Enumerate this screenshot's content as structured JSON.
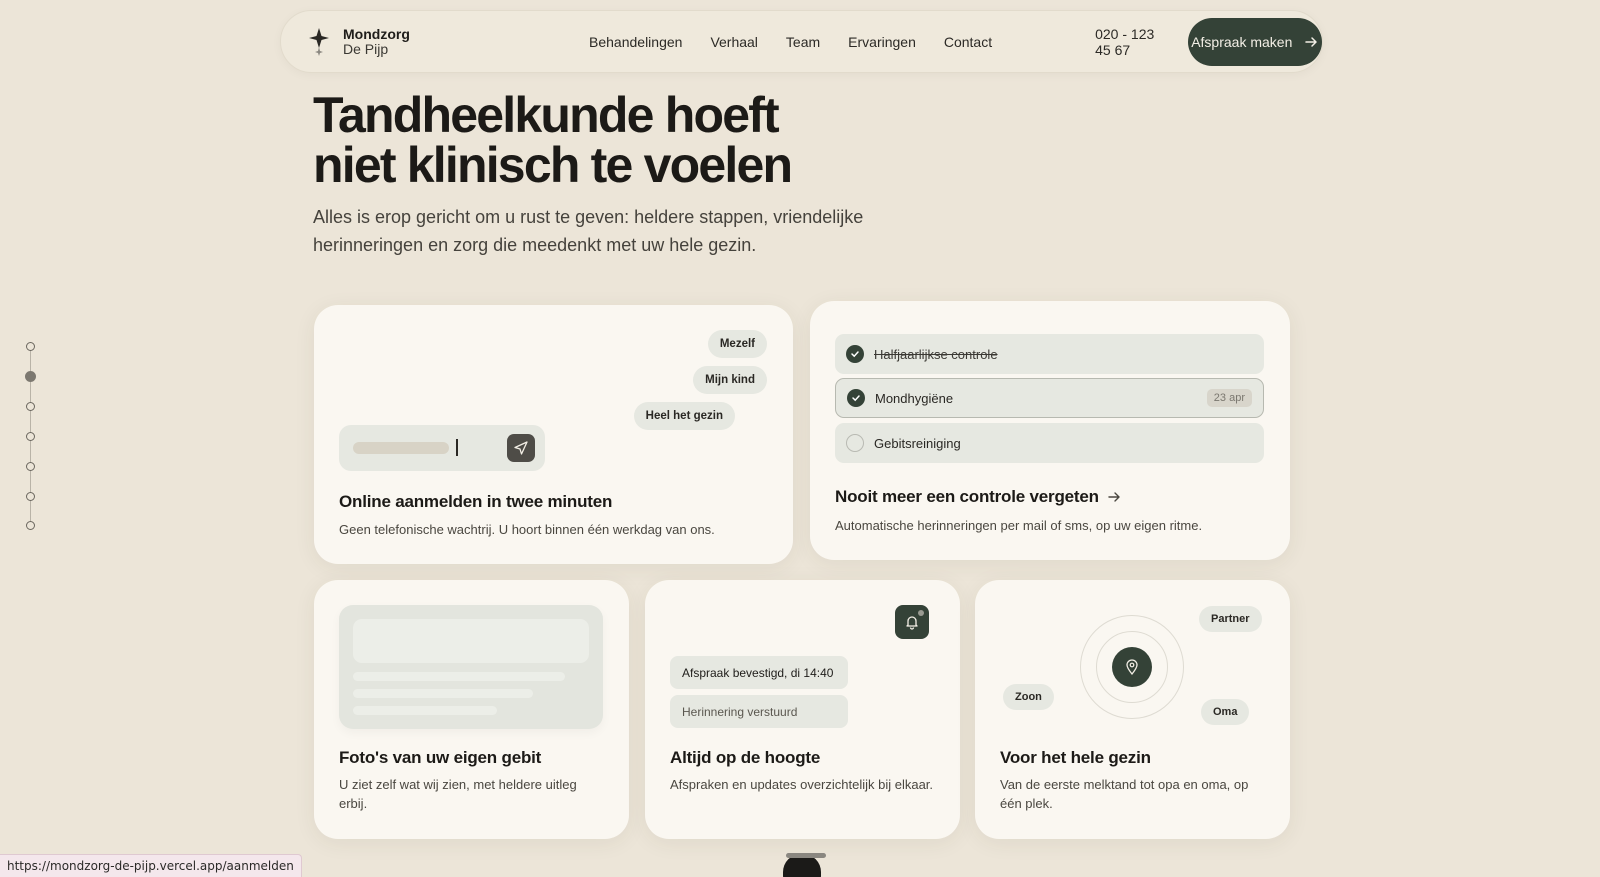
{
  "brand": {
    "name": "Mondzorg",
    "sub": "De Pijp"
  },
  "nav": {
    "items": [
      "Behandelingen",
      "Verhaal",
      "Team",
      "Ervaringen",
      "Contact"
    ],
    "phone": "020 - 123 45 67",
    "cta": "Afspraak maken"
  },
  "hero": {
    "title_line1": "Tandheelkunde hoeft",
    "title_line2": "niet klinisch te voelen",
    "subtitle": "Alles is erop gericht om u rust te geven: heldere stappen, vriendelijke herinneringen en zorg die meedenkt met uw hele gezin."
  },
  "cards": {
    "signup": {
      "chips": [
        "Mezelf",
        "Mijn kind",
        "Heel het gezin"
      ],
      "title": "Online aanmelden in twee minuten",
      "desc": "Geen telefonische wachtrij. U hoort binnen één werkdag van ons."
    },
    "reminders": {
      "tasks": [
        {
          "label": "Halfjaarlijkse controle",
          "done": true
        },
        {
          "label": "Mondhygiëne",
          "done": true,
          "date": "23 apr"
        },
        {
          "label": "Gebitsreiniging",
          "done": false
        }
      ],
      "title": "Nooit meer een controle vergeten",
      "desc": "Automatische herinneringen per mail of sms, op uw eigen ritme."
    },
    "photos": {
      "title": "Foto's van uw eigen gebit",
      "desc": "U ziet zelf wat wij zien, met heldere uitleg erbij."
    },
    "updates": {
      "notifications": [
        "Afspraak bevestigd, di 14:40",
        "Herinnering verstuurd"
      ],
      "title": "Altijd op de hoogte",
      "desc": "Afspraken en updates overzichtelijk bij elkaar."
    },
    "family": {
      "chips": [
        "Partner",
        "Zoon",
        "Oma"
      ],
      "title": "Voor het hele gezin",
      "desc": "Van de eerste melktand tot opa en oma, op één plek."
    }
  },
  "status_url": "https://mondzorg-de-pijp.vercel.app/aanmelden",
  "colors": {
    "accent": "#344237",
    "background": "#ece5d8",
    "card": "#faf7f1",
    "chip": "#e6e8e1"
  }
}
